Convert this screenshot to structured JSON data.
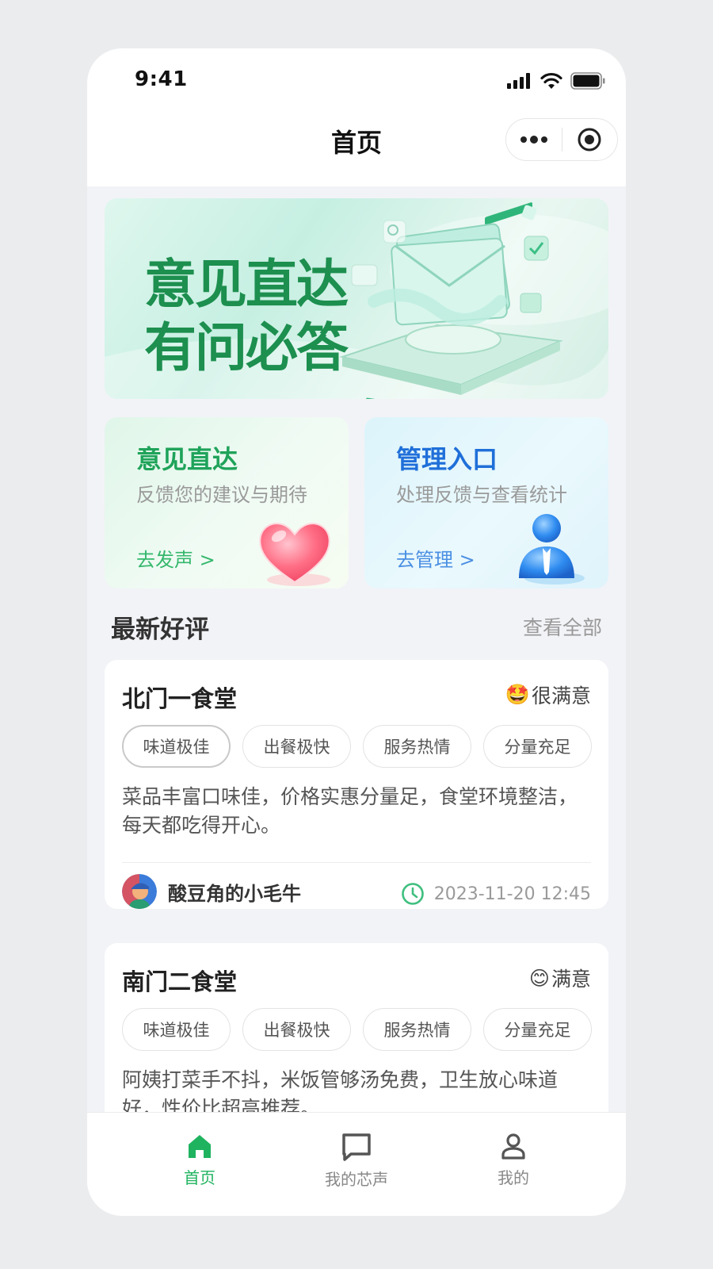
{
  "status_bar": {
    "time": "9:41"
  },
  "navbar": {
    "title": "首页"
  },
  "banner": {
    "line1": "意见直达",
    "line2": "有问必答"
  },
  "cards": [
    {
      "title": "意见直达",
      "subtitle": "反馈您的建议与期待",
      "link": "去发声 >"
    },
    {
      "title": "管理入口",
      "subtitle": "处理反馈与查看统计",
      "link": "去管理 >"
    }
  ],
  "section": {
    "title": "最新好评",
    "link": "查看全部"
  },
  "reviews": [
    {
      "name": "北门一食堂",
      "rating_emoji": "🤩",
      "rating": "很满意",
      "tags": [
        "味道极佳",
        "出餐极快",
        "服务热情",
        "分量充足"
      ],
      "text": "菜品丰富口味佳，价格实惠分量足，食堂环境整洁，每天都吃得开心。",
      "user": "酸豆角的小毛牛",
      "time": "2023-11-20 12:45"
    },
    {
      "name": "南门二食堂",
      "rating_emoji": "😊",
      "rating": "满意",
      "tags": [
        "味道极佳",
        "出餐极快",
        "服务热情",
        "分量充足"
      ],
      "text": "阿姨打菜手不抖，米饭管够汤免费，卫生放心味道好，性价比超高推荐。"
    }
  ],
  "tabbar": {
    "items": [
      {
        "label": "首页",
        "icon": "home-icon",
        "active": true
      },
      {
        "label": "我的芯声",
        "icon": "message-icon",
        "active": false
      },
      {
        "label": "我的",
        "icon": "person-icon",
        "active": false
      }
    ]
  },
  "colors": {
    "accent": "#1fb35f",
    "brand_green": "#1d8f4f",
    "brand_blue": "#1f6fd9"
  }
}
